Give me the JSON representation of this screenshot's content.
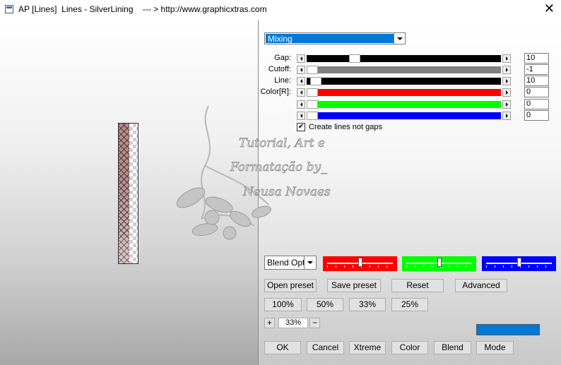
{
  "window": {
    "title": "AP [Lines]  Lines - SilverLining    --- > http://www.graphicxtras.com",
    "close_glyph": "✕"
  },
  "mode_select": {
    "value": "Mixing"
  },
  "sliders": [
    {
      "label": "Gap:",
      "value": "10",
      "fill": "#000000",
      "level": 0.23
    },
    {
      "label": "Cutoff:",
      "value": "-1",
      "fill": "#808080",
      "level": 0.0
    },
    {
      "label": "Line:",
      "value": "10",
      "fill": "#000000",
      "level": 0.02
    },
    {
      "label": "Color[R]:",
      "value": "0",
      "fill": "#ff0000",
      "level": 0.0
    },
    {
      "label": "",
      "value": "0",
      "fill": "#00ff00",
      "level": 0.0
    },
    {
      "label": "",
      "value": "0",
      "fill": "#0000ff",
      "level": 0.0
    }
  ],
  "checkbox": {
    "label": "Create lines not gaps",
    "checked": true,
    "glyph": "✔"
  },
  "watermark": {
    "lines": [
      "Tutorial, Art e",
      "Formatação by_",
      "Neusa Novaes"
    ]
  },
  "blend_options": {
    "value": "Blend Opti"
  },
  "color_sliders": [
    {
      "color": "#ff0000",
      "level": 0.5
    },
    {
      "color": "#00ff00",
      "level": 0.5
    },
    {
      "color": "#0000ff",
      "level": 0.5
    }
  ],
  "preset_buttons": {
    "open": "Open preset",
    "save": "Save preset",
    "reset": "Reset",
    "advanced": "Advanced"
  },
  "zoom_buttons": [
    "100%",
    "50%",
    "33%",
    "25%"
  ],
  "zoom": {
    "plus": "+",
    "minus": "−",
    "value": "33%"
  },
  "accent_color": "#0078d7",
  "bottom_buttons": {
    "ok": "OK",
    "cancel": "Cancel",
    "xtreme": "Xtreme",
    "color": "Color",
    "blend": "Blend",
    "mode": "Mode"
  }
}
